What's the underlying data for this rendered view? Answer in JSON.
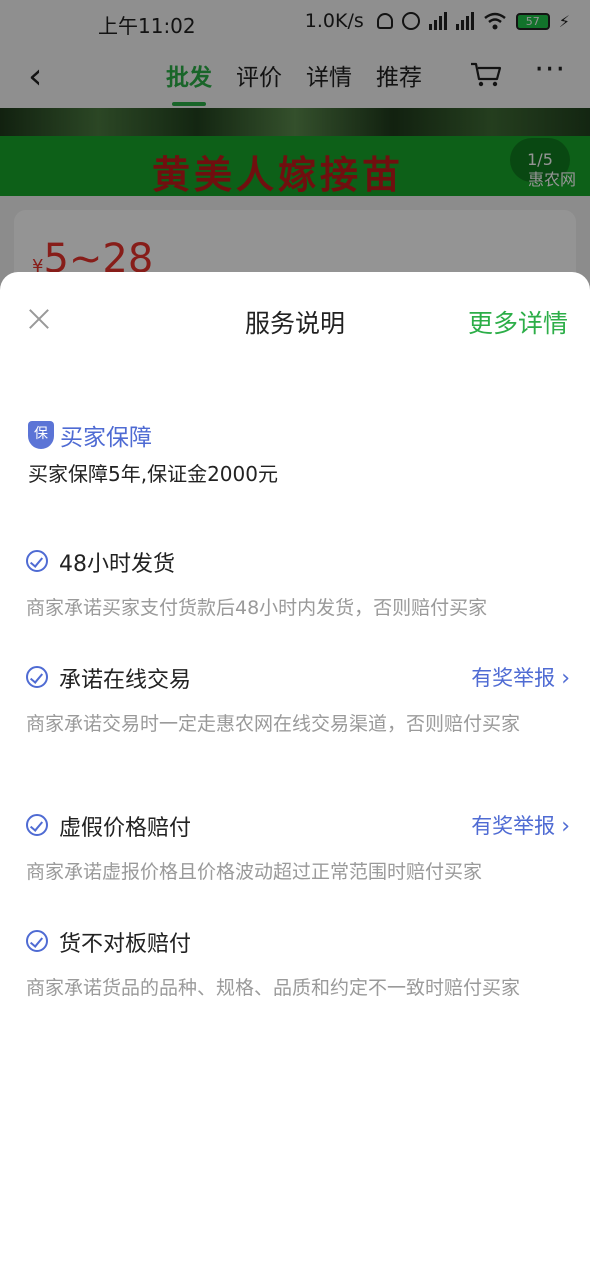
{
  "status_bar": {
    "time": "上午11:02",
    "speed": "1.0K/s",
    "battery": "57"
  },
  "nav": {
    "tabs": [
      "批发",
      "评价",
      "详情",
      "推荐"
    ],
    "more": "···"
  },
  "banner": {
    "title": "黄美人嫁接苗",
    "counter": "1/5",
    "logo": "惠农网"
  },
  "product": {
    "price_symbol": "¥",
    "price": "5~28"
  },
  "sheet": {
    "title": "服务说明",
    "more_details": "更多详情",
    "guarantee": {
      "icon_text": "保",
      "label": "买家保障",
      "description": "买家保障5年,保证金2000元"
    },
    "items": [
      {
        "title": "48小时发货",
        "link": "",
        "description": "商家承诺买家支付货款后48小时内发货，否则赔付买家"
      },
      {
        "title": "承诺在线交易",
        "link": "有奖举报",
        "description": "商家承诺交易时一定走惠农网在线交易渠道，否则赔付买家"
      },
      {
        "title": "虚假价格赔付",
        "link": "有奖举报",
        "description": "商家承诺虚报价格且价格波动超过正常范围时赔付买家"
      },
      {
        "title": "货不对板赔付",
        "link": "",
        "description": "商家承诺货品的品种、规格、品质和约定不一致时赔付买家"
      }
    ]
  },
  "colors": {
    "brand_green": "#2cae48",
    "guarantee_blue": "#4f6bd3",
    "price_red": "#e9322c"
  }
}
